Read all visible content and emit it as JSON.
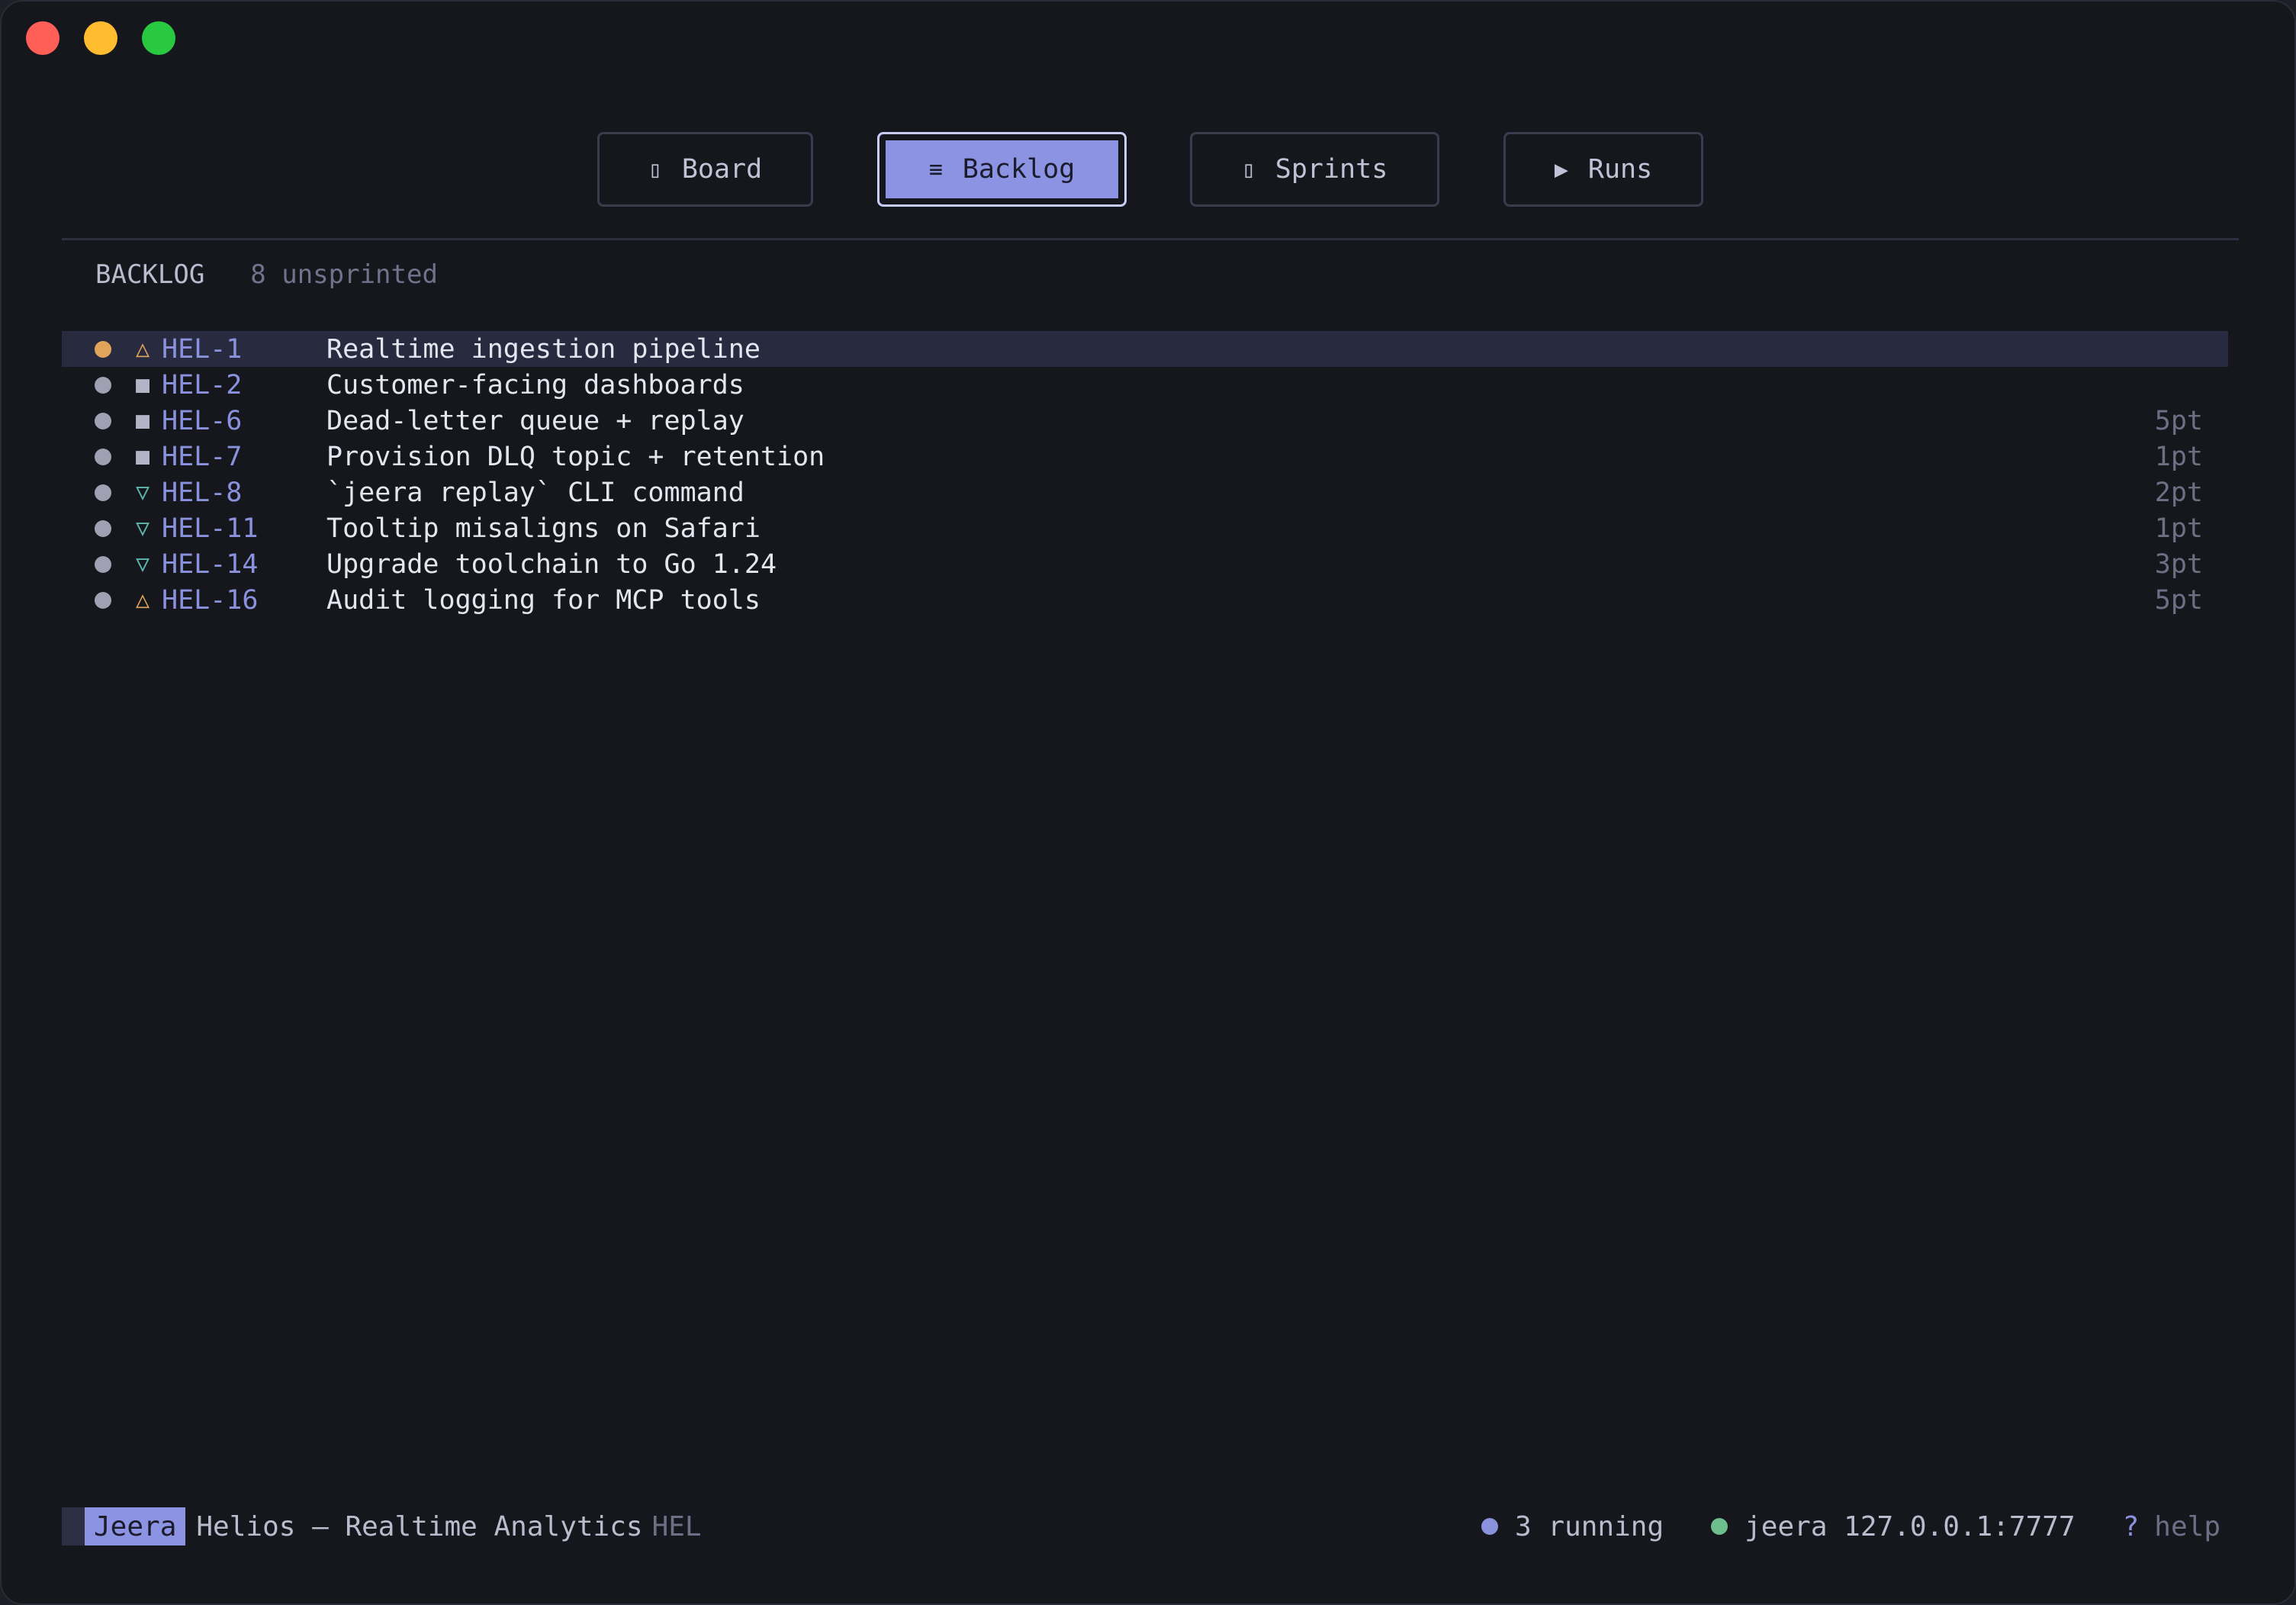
{
  "tabs": [
    {
      "label": "Board",
      "icon": "board-icon",
      "glyph": "▯",
      "active": false
    },
    {
      "label": "Backlog",
      "icon": "list-icon",
      "glyph": "≡",
      "active": true
    },
    {
      "label": "Sprints",
      "icon": "sprint-icon",
      "glyph": "▯",
      "active": false
    },
    {
      "label": "Runs",
      "icon": "play-icon",
      "glyph": "▶",
      "active": false
    }
  ],
  "section": {
    "title": "BACKLOG",
    "count_text": "8 unsprinted"
  },
  "issues": [
    {
      "key": "HEL-1",
      "title": "Realtime ingestion pipeline",
      "points": "",
      "priority": "high",
      "priority_glyph": "△",
      "status_color": "#e0a55a",
      "priority_color": "#e0a55a",
      "selected": true
    },
    {
      "key": "HEL-2",
      "title": "Customer-facing dashboards",
      "points": "",
      "priority": "medium",
      "priority_glyph": "■",
      "status_color": "#9fa1b3",
      "priority_color": "#b3b5c7",
      "selected": false
    },
    {
      "key": "HEL-6",
      "title": "Dead-letter queue + replay",
      "points": "5pt",
      "priority": "medium",
      "priority_glyph": "■",
      "status_color": "#9fa1b3",
      "priority_color": "#b3b5c7",
      "selected": false
    },
    {
      "key": "HEL-7",
      "title": "Provision DLQ topic + retention",
      "points": "1pt",
      "priority": "medium",
      "priority_glyph": "■",
      "status_color": "#9fa1b3",
      "priority_color": "#b3b5c7",
      "selected": false
    },
    {
      "key": "HEL-8",
      "title": "`jeera replay` CLI command",
      "points": "2pt",
      "priority": "low",
      "priority_glyph": "▽",
      "status_color": "#9fa1b3",
      "priority_color": "#5cb8b0",
      "selected": false
    },
    {
      "key": "HEL-11",
      "title": "Tooltip misaligns on Safari",
      "points": "1pt",
      "priority": "low",
      "priority_glyph": "▽",
      "status_color": "#9fa1b3",
      "priority_color": "#5cb8b0",
      "selected": false
    },
    {
      "key": "HEL-14",
      "title": "Upgrade toolchain to Go 1.24",
      "points": "3pt",
      "priority": "low",
      "priority_glyph": "▽",
      "status_color": "#9fa1b3",
      "priority_color": "#5cb8b0",
      "selected": false
    },
    {
      "key": "HEL-16",
      "title": "Audit logging for MCP tools",
      "points": "5pt",
      "priority": "high",
      "priority_glyph": "△",
      "status_color": "#9fa1b3",
      "priority_color": "#e0a55a",
      "selected": false
    }
  ],
  "footer": {
    "app_name": "Jeera",
    "project_name": "Helios — Realtime Analytics",
    "project_key": "HEL",
    "running_text": "3 running",
    "running_color": "#8a92de",
    "server_text": "jeera 127.0.0.1:7777",
    "server_color": "#6fbf8e",
    "help_key": "?",
    "help_label": "help"
  },
  "colors": {
    "accent": "#8c93e2",
    "background": "#16161d",
    "selected_row": "#282b40"
  }
}
